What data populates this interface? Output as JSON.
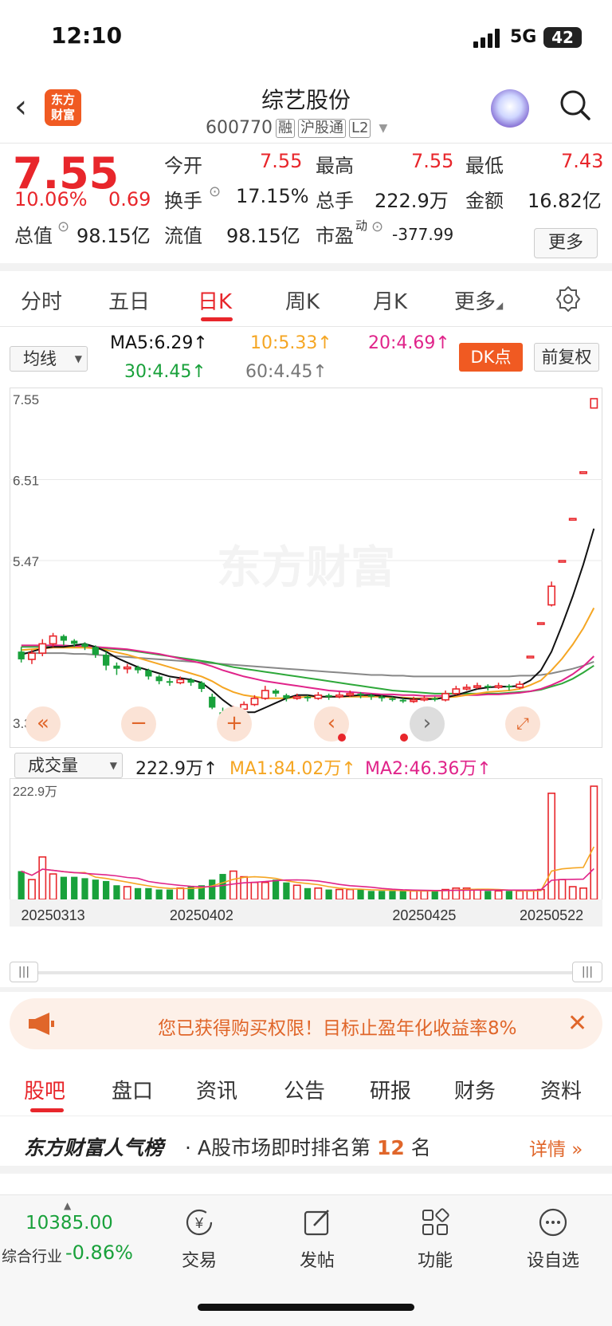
{
  "status": {
    "time": "12:10",
    "network": "5G",
    "battery": "42"
  },
  "header": {
    "name": "综艺股份",
    "code": "600770",
    "tags": [
      "融",
      "沪股通",
      "L2"
    ],
    "logo_text": "东方\n财富"
  },
  "quote": {
    "price": "7.55",
    "change_pct": "10.06%",
    "change": "0.69",
    "open_label": "今开",
    "open": "7.55",
    "high_label": "最高",
    "high": "7.55",
    "low_label": "最低",
    "low": "7.43",
    "turnover_label": "换手",
    "turnover": "17.15%",
    "volume_label": "总手",
    "volume": "222.9万",
    "amount_label": "金额",
    "amount": "16.82亿",
    "mktcap_label": "总值",
    "mktcap": "98.15亿",
    "float_label": "流值",
    "float": "98.15亿",
    "pe_label": "市盈",
    "pe_sup": "动",
    "pe": "-377.99",
    "more": "更多"
  },
  "ktabs": [
    "分时",
    "五日",
    "日K",
    "周K",
    "月K",
    "更多"
  ],
  "ma": {
    "selector": "均线",
    "ma5": "MA5:6.29↑",
    "ma10": "10:5.33↑",
    "ma20": "20:4.69↑",
    "ma30": "30:4.45↑",
    "ma60": "60:4.45↑",
    "dk": "DK点",
    "fuquan": "前复权"
  },
  "vol": {
    "selector": "成交量",
    "value": "222.9万↑",
    "ma1": "MA1:84.02万↑",
    "ma2": "MA2:46.36万↑"
  },
  "colors": {
    "up": "#e8262b",
    "down": "#19a13b",
    "ma5": "#111111",
    "ma10": "#f5a623",
    "ma20": "#e0248a",
    "ma30": "#2ea83a",
    "ma60": "#888888"
  },
  "chart_data": {
    "type": "candlestick",
    "price_axis": [
      "7.55",
      "6.51",
      "5.47",
      "3.39"
    ],
    "ylim": [
      3.39,
      7.55
    ],
    "volume_axis": [
      "222.9万"
    ],
    "dates": [
      "20250313",
      "20250402",
      "20250425",
      "20250522"
    ],
    "watermark": "东方财富",
    "candles": [
      [
        4.3,
        4.2,
        4.36,
        4.16
      ],
      [
        4.2,
        4.28,
        4.32,
        4.14
      ],
      [
        4.28,
        4.4,
        4.46,
        4.24
      ],
      [
        4.4,
        4.5,
        4.54,
        4.36
      ],
      [
        4.5,
        4.44,
        4.52,
        4.38
      ],
      [
        4.44,
        4.4,
        4.46,
        4.36
      ],
      [
        4.4,
        4.36,
        4.42,
        4.32
      ],
      [
        4.36,
        4.26,
        4.38,
        4.22
      ],
      [
        4.26,
        4.12,
        4.3,
        4.06
      ],
      [
        4.12,
        4.08,
        4.16,
        4.0
      ],
      [
        4.08,
        4.1,
        4.14,
        4.02
      ],
      [
        4.1,
        4.06,
        4.12,
        4.02
      ],
      [
        4.06,
        3.98,
        4.08,
        3.94
      ],
      [
        3.98,
        3.92,
        4.0,
        3.88
      ],
      [
        3.92,
        3.9,
        3.96,
        3.86
      ],
      [
        3.9,
        3.94,
        3.98,
        3.88
      ],
      [
        3.94,
        3.9,
        3.96,
        3.86
      ],
      [
        3.9,
        3.82,
        3.92,
        3.78
      ],
      [
        3.72,
        3.58,
        3.76,
        3.56
      ],
      [
        3.52,
        3.42,
        3.58,
        3.34
      ],
      [
        3.42,
        3.54,
        3.6,
        3.3
      ],
      [
        3.56,
        3.62,
        3.66,
        3.56
      ],
      [
        3.62,
        3.7,
        3.74,
        3.6
      ],
      [
        3.7,
        3.8,
        3.86,
        3.68
      ],
      [
        3.8,
        3.76,
        3.82,
        3.72
      ],
      [
        3.74,
        3.7,
        3.76,
        3.66
      ],
      [
        3.7,
        3.72,
        3.76,
        3.68
      ],
      [
        3.72,
        3.7,
        3.74,
        3.66
      ],
      [
        3.7,
        3.74,
        3.78,
        3.68
      ],
      [
        3.74,
        3.72,
        3.76,
        3.68
      ],
      [
        3.72,
        3.74,
        3.78,
        3.7
      ],
      [
        3.74,
        3.76,
        3.8,
        3.72
      ],
      [
        3.76,
        3.74,
        3.78,
        3.7
      ],
      [
        3.74,
        3.72,
        3.76,
        3.68
      ],
      [
        3.72,
        3.7,
        3.74,
        3.66
      ],
      [
        3.7,
        3.68,
        3.72,
        3.66
      ],
      [
        3.68,
        3.66,
        3.7,
        3.64
      ],
      [
        3.66,
        3.68,
        3.72,
        3.64
      ],
      [
        3.68,
        3.7,
        3.74,
        3.66
      ],
      [
        3.7,
        3.68,
        3.72,
        3.66
      ],
      [
        3.68,
        3.76,
        3.8,
        3.66
      ],
      [
        3.76,
        3.82,
        3.86,
        3.74
      ],
      [
        3.82,
        3.84,
        3.88,
        3.8
      ],
      [
        3.84,
        3.86,
        3.9,
        3.82
      ],
      [
        3.86,
        3.84,
        3.88,
        3.8
      ],
      [
        3.84,
        3.86,
        3.9,
        3.82
      ],
      [
        3.86,
        3.84,
        3.88,
        3.8
      ],
      [
        3.84,
        3.88,
        3.92,
        3.82
      ],
      [
        4.24,
        4.24,
        4.24,
        4.24
      ],
      [
        4.67,
        4.67,
        4.67,
        4.67
      ],
      [
        4.9,
        5.14,
        5.2,
        4.88
      ],
      [
        5.47,
        5.47,
        5.47,
        5.47
      ],
      [
        6.01,
        6.01,
        6.01,
        6.01
      ],
      [
        6.61,
        6.61,
        6.61,
        6.61
      ],
      [
        7.43,
        7.55,
        7.55,
        7.43
      ]
    ],
    "volumes": [
      20,
      14,
      30,
      18,
      16,
      16,
      15,
      14,
      13,
      10,
      9,
      8,
      8,
      7,
      7,
      8,
      9,
      10,
      14,
      18,
      20,
      16,
      12,
      12,
      14,
      12,
      10,
      8,
      8,
      7,
      7,
      7,
      7,
      6,
      6,
      6,
      6,
      6,
      6,
      6,
      7,
      8,
      8,
      7,
      6,
      6,
      6,
      6,
      6,
      7,
      75,
      14,
      9,
      8,
      80
    ],
    "ma5": [
      4.26,
      4.3,
      4.34,
      4.36,
      4.36,
      4.38,
      4.4,
      4.36,
      4.3,
      4.22,
      4.16,
      4.1,
      4.06,
      4.02,
      3.98,
      3.96,
      3.94,
      3.9,
      3.8,
      3.68,
      3.58,
      3.52,
      3.52,
      3.58,
      3.64,
      3.7,
      3.74,
      3.74,
      3.72,
      3.72,
      3.72,
      3.73,
      3.74,
      3.74,
      3.73,
      3.72,
      3.7,
      3.69,
      3.69,
      3.69,
      3.71,
      3.74,
      3.78,
      3.82,
      3.84,
      3.85,
      3.85,
      3.86,
      3.93,
      4.06,
      4.3,
      4.64,
      5.01,
      5.42,
      5.88
    ],
    "ma10": [
      4.32,
      4.33,
      4.34,
      4.35,
      4.35,
      4.35,
      4.35,
      4.34,
      4.32,
      4.29,
      4.26,
      4.22,
      4.18,
      4.14,
      4.1,
      4.06,
      4.02,
      3.98,
      3.92,
      3.84,
      3.78,
      3.74,
      3.72,
      3.7,
      3.7,
      3.7,
      3.71,
      3.72,
      3.72,
      3.72,
      3.72,
      3.72,
      3.72,
      3.72,
      3.72,
      3.71,
      3.71,
      3.7,
      3.7,
      3.7,
      3.71,
      3.72,
      3.74,
      3.76,
      3.78,
      3.79,
      3.8,
      3.82,
      3.87,
      3.93,
      4.06,
      4.21,
      4.39,
      4.6,
      4.86
    ],
    "ma20": [
      4.38,
      4.38,
      4.38,
      4.38,
      4.38,
      4.37,
      4.37,
      4.36,
      4.35,
      4.34,
      4.33,
      4.31,
      4.29,
      4.27,
      4.24,
      4.21,
      4.18,
      4.15,
      4.11,
      4.06,
      4.02,
      3.98,
      3.95,
      3.92,
      3.9,
      3.88,
      3.86,
      3.84,
      3.82,
      3.8,
      3.79,
      3.78,
      3.77,
      3.76,
      3.75,
      3.75,
      3.74,
      3.74,
      3.73,
      3.73,
      3.73,
      3.73,
      3.74,
      3.74,
      3.75,
      3.75,
      3.76,
      3.77,
      3.79,
      3.82,
      3.87,
      3.93,
      4.01,
      4.11,
      4.24
    ],
    "ma30": [
      4.36,
      4.36,
      4.36,
      4.36,
      4.36,
      4.36,
      4.36,
      4.35,
      4.34,
      4.33,
      4.32,
      4.3,
      4.28,
      4.26,
      4.24,
      4.22,
      4.2,
      4.18,
      4.16,
      4.13,
      4.1,
      4.08,
      4.06,
      4.04,
      4.02,
      4.0,
      3.98,
      3.96,
      3.94,
      3.92,
      3.9,
      3.88,
      3.86,
      3.84,
      3.82,
      3.8,
      3.79,
      3.78,
      3.77,
      3.76,
      3.76,
      3.76,
      3.76,
      3.76,
      3.76,
      3.76,
      3.77,
      3.78,
      3.79,
      3.81,
      3.85,
      3.89,
      3.95,
      4.03,
      4.12
    ],
    "ma60": [
      4.28,
      4.28,
      4.28,
      4.28,
      4.28,
      4.27,
      4.27,
      4.26,
      4.25,
      4.24,
      4.23,
      4.22,
      4.21,
      4.2,
      4.19,
      4.18,
      4.17,
      4.16,
      4.15,
      4.14,
      4.13,
      4.12,
      4.11,
      4.1,
      4.09,
      4.08,
      4.07,
      4.06,
      4.05,
      4.04,
      4.03,
      4.02,
      4.01,
      4.0,
      4.0,
      3.99,
      3.99,
      3.98,
      3.98,
      3.98,
      3.98,
      3.98,
      3.98,
      3.98,
      3.98,
      3.98,
      3.98,
      3.99,
      3.99,
      4.0,
      4.02,
      4.05,
      4.08,
      4.12,
      4.17
    ]
  },
  "banner": {
    "text": "您已获得购买权限！目标止盈年化收益率8%",
    "close": "✕"
  },
  "btabs": [
    "股吧",
    "盘口",
    "资讯",
    "公告",
    "研报",
    "财务",
    "资料"
  ],
  "rank": {
    "brand": "东方财富人气榜",
    "text_pre": "· A股市场即时排名第",
    "num": "12",
    "text_post": "名",
    "detail": "详情 »"
  },
  "footer": {
    "index_value": "10385.00",
    "index_name": "综合行业",
    "index_change": "-0.86%",
    "items": [
      "交易",
      "发帖",
      "功能",
      "设自选"
    ]
  }
}
